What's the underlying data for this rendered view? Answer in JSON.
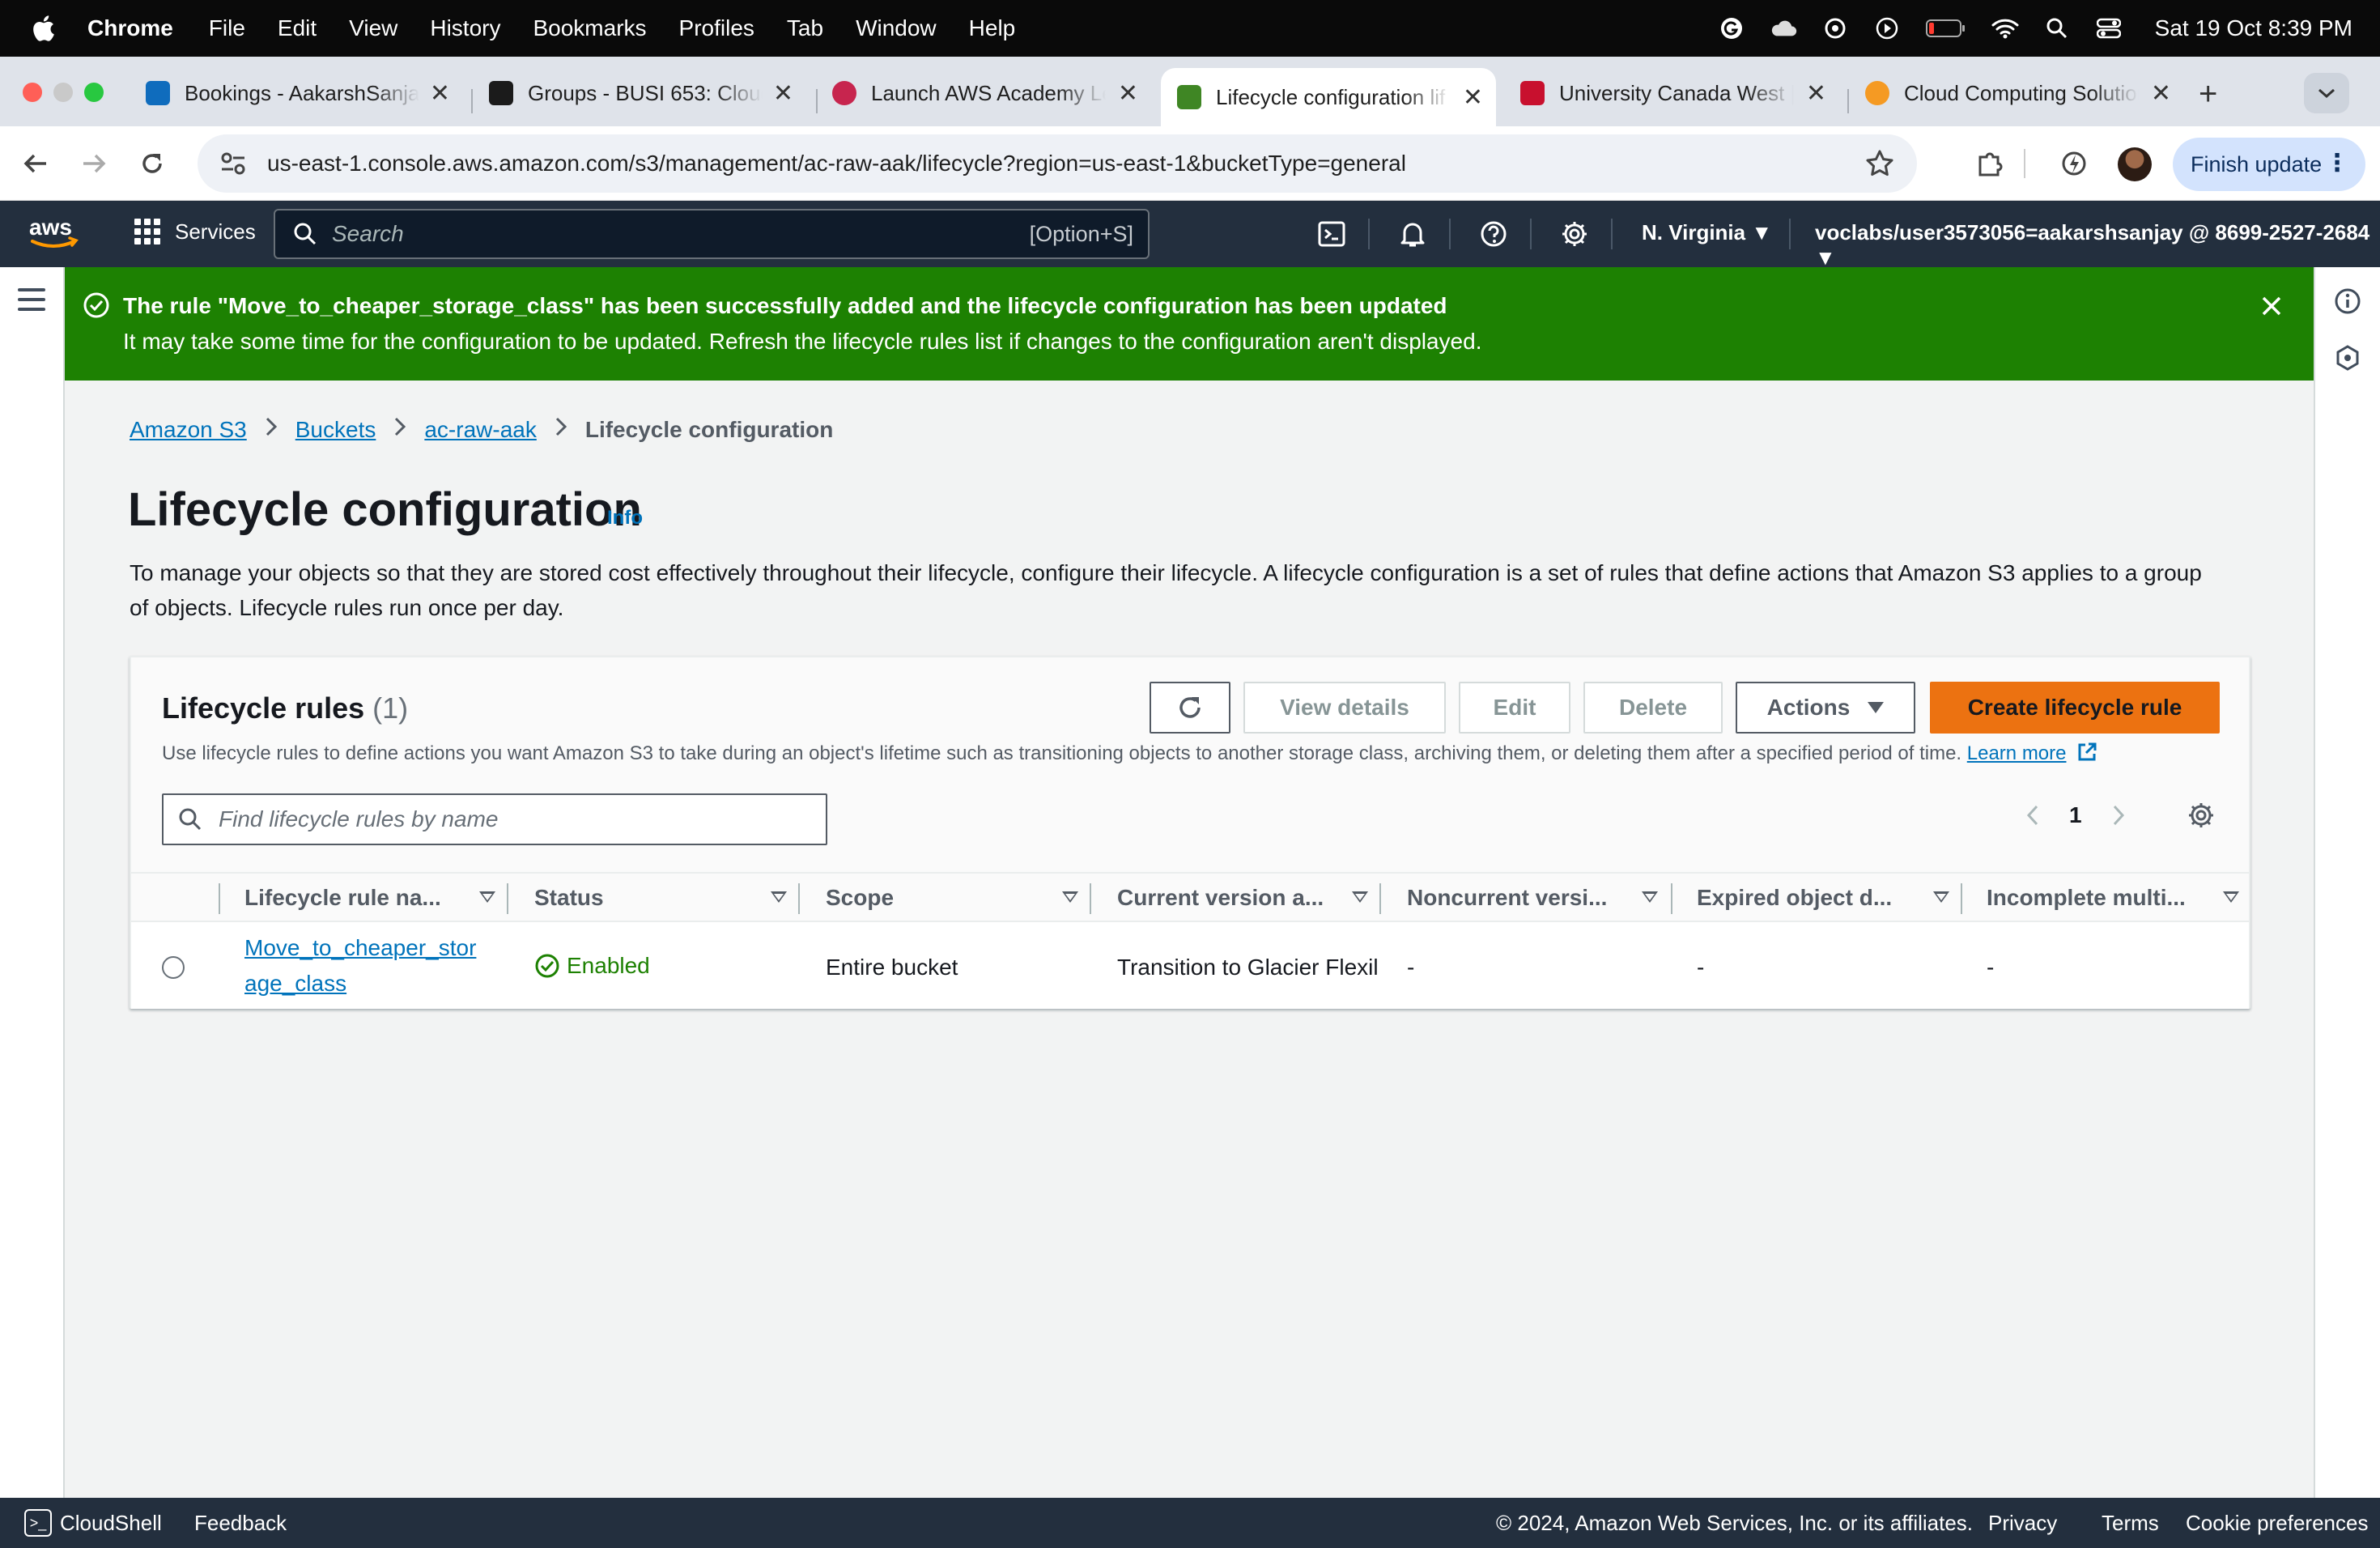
{
  "menubar": {
    "app": "Chrome",
    "items": [
      "File",
      "Edit",
      "View",
      "History",
      "Bookmarks",
      "Profiles",
      "Tab",
      "Window",
      "Help"
    ],
    "clock": "Sat 19 Oct  8:39 PM"
  },
  "tabs": [
    {
      "title": "Bookings - AakarshSanjay",
      "favicon": "bookings-icon",
      "color": "#0f6cbd"
    },
    {
      "title": "Groups - BUSI 653: Cloud",
      "favicon": "d2l-icon",
      "color": "#1b1b1b"
    },
    {
      "title": "Launch AWS Academy Lea",
      "favicon": "aws-academy-icon",
      "color": "#c7254e"
    },
    {
      "title": "Lifecycle configuration lif",
      "favicon": "s3-icon",
      "color": "#3f8624",
      "active": true
    },
    {
      "title": "University Canada West |",
      "favicon": "ucw-icon",
      "color": "#c8102e"
    },
    {
      "title": "Cloud Computing Solution",
      "favicon": "cloud-icon",
      "color": "#f59a23"
    }
  ],
  "omnibox": {
    "url": "us-east-1.console.aws.amazon.com/s3/management/ac-raw-aak/lifecycle?region=us-east-1&bucketType=general"
  },
  "toolbar": {
    "finish_update": "Finish update"
  },
  "aws_header": {
    "services": "Services",
    "search_placeholder": "Search",
    "search_shortcut": "[Option+S]",
    "region": "N. Virginia",
    "account": "voclabs/user3573056=aakarshsanjay @ 8699-2527-2684"
  },
  "flash": {
    "title": "The rule \"Move_to_cheaper_storage_class\" has been successfully added and the lifecycle configuration has been updated",
    "message": "It may take some time for the configuration to be updated. Refresh the lifecycle rules list if changes to the configuration aren't displayed.",
    "color": "#1d8102"
  },
  "breadcrumb": [
    "Amazon S3",
    "Buckets",
    "ac-raw-aak",
    "Lifecycle configuration"
  ],
  "page": {
    "title": "Lifecycle configuration",
    "info": "Info",
    "description": "To manage your objects so that they are stored cost effectively throughout their lifecycle, configure their lifecycle. A lifecycle configuration is a set of rules that define actions that Amazon S3 applies to a group of objects. Lifecycle rules run once per day."
  },
  "panel": {
    "title": "Lifecycle rules",
    "count": "(1)",
    "description": "Use lifecycle rules to define actions you want Amazon S3 to take during an object's lifetime such as transitioning objects to another storage class, archiving them, or deleting them after a specified period of time.",
    "learn_more": "Learn more",
    "buttons": {
      "view_details": "View details",
      "edit": "Edit",
      "delete": "Delete",
      "actions": "Actions",
      "create": "Create lifecycle rule"
    },
    "filter_placeholder": "Find lifecycle rules by name",
    "page_number": "1",
    "primary_color": "#ec7211"
  },
  "table": {
    "columns": [
      "Lifecycle rule na...",
      "Status",
      "Scope",
      "Current version a...",
      "Noncurrent versi...",
      "Expired object d...",
      "Incomplete multi..."
    ],
    "rows": [
      {
        "name_line1": "Move_to_cheaper_stor",
        "name_line2": "age_class",
        "status": "Enabled",
        "scope": "Entire bucket",
        "current": "Transition to Glacier Flexil",
        "noncurrent": "-",
        "expired": "-",
        "incomplete": "-"
      }
    ]
  },
  "footer": {
    "cloudshell": "CloudShell",
    "feedback": "Feedback",
    "copyright": "© 2024, Amazon Web Services, Inc. or its affiliates.",
    "privacy": "Privacy",
    "terms": "Terms",
    "cookies": "Cookie preferences"
  }
}
